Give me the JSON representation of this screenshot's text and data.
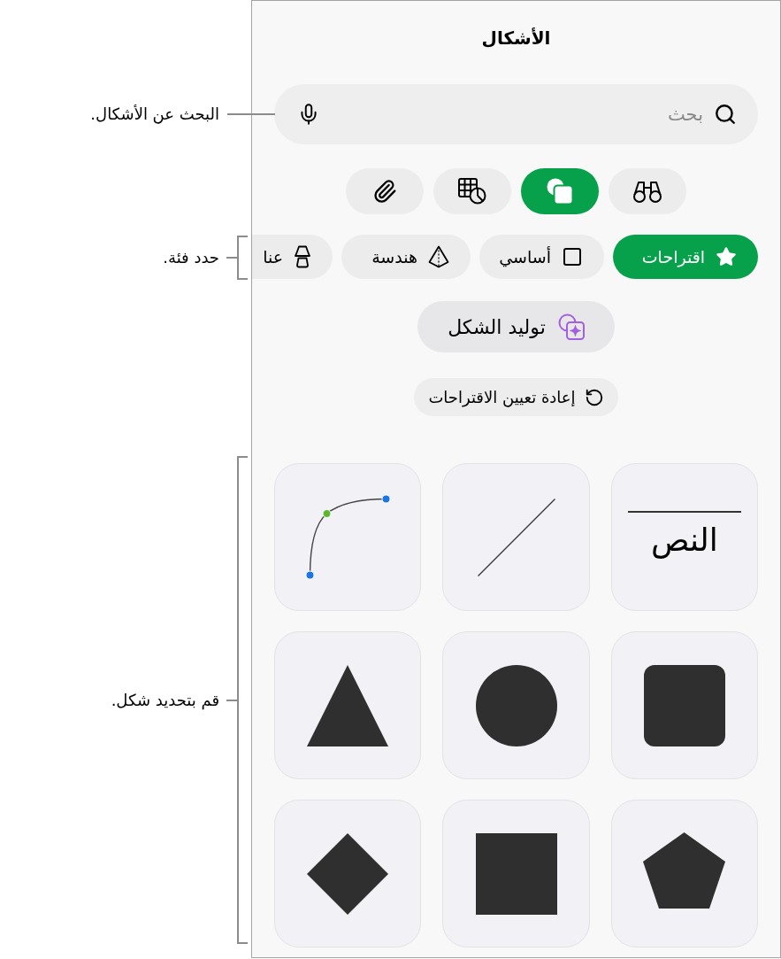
{
  "callouts": [
    {
      "kind": "line",
      "text": "البحث عن الأشكال."
    },
    {
      "kind": "bracket",
      "text": "حدد فئة."
    },
    {
      "kind": "bracket",
      "text": "قم بتحديد شكل."
    }
  ],
  "panel": {
    "title": "الأشكال",
    "search": {
      "placeholder": "بحث"
    },
    "source_tabs": [
      {
        "selected": false
      },
      {
        "selected": true
      },
      {
        "selected": false
      },
      {
        "selected": false
      }
    ],
    "categories": [
      {
        "label": "اقتراحات",
        "selected": true
      },
      {
        "label": "أساسي",
        "selected": false
      },
      {
        "label": "هندسة",
        "selected": false
      },
      {
        "label": "عنا",
        "selected": false
      }
    ],
    "generate_button": {
      "label": "توليد الشكل"
    },
    "reset_button": {
      "label": "إعادة تعيين الاقتراحات"
    },
    "shapes": [
      {
        "kind": "text",
        "label": "النص"
      },
      {
        "kind": "line"
      },
      {
        "kind": "curve"
      },
      {
        "kind": "rounded-square"
      },
      {
        "kind": "circle"
      },
      {
        "kind": "triangle"
      },
      {
        "kind": "pentagon"
      },
      {
        "kind": "square"
      },
      {
        "kind": "diamond"
      }
    ]
  }
}
